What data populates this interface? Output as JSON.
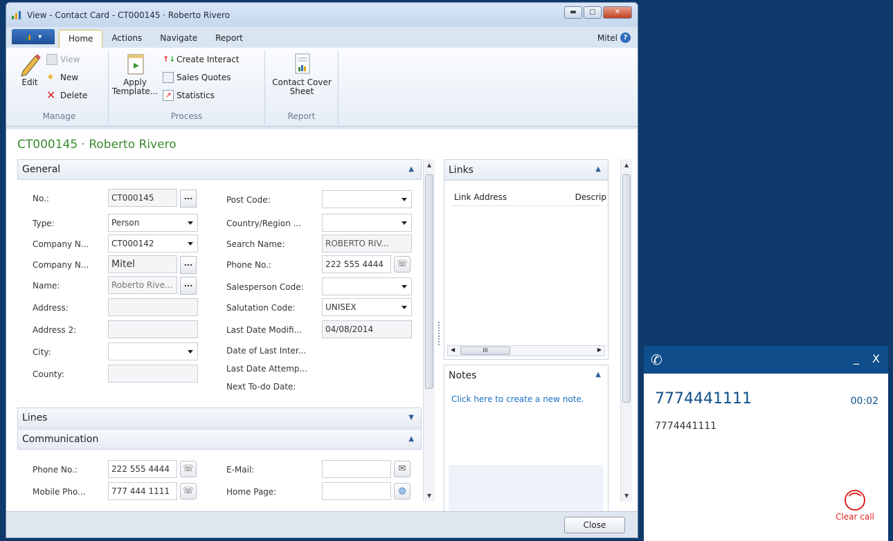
{
  "window": {
    "title": "View - Contact Card - CT000145 · Roberto Rivero"
  },
  "tabs": [
    "Home",
    "Actions",
    "Navigate",
    "Report"
  ],
  "company_label": "Mitel",
  "ribbon": {
    "manage": {
      "edit": "Edit",
      "view": "View",
      "new": "New",
      "delete": "Delete",
      "label": "Manage"
    },
    "process": {
      "apply_template": "Apply Template...",
      "create_interact": "Create Interact",
      "sales_quotes": "Sales Quotes",
      "statistics": "Statistics",
      "label": "Process"
    },
    "report": {
      "cover_sheet": "Contact Cover Sheet",
      "label": "Report"
    }
  },
  "page_title": "CT000145 · Roberto Rivero",
  "general": {
    "header": "General",
    "no_label": "No.:",
    "no_value": "CT000145",
    "type_label": "Type:",
    "type_value": "Person",
    "company_no_label": "Company N...",
    "company_no_value": "CT000142",
    "company_name_label": "Company N...",
    "company_name_value": "Mitel",
    "name_label": "Name:",
    "name_value": "Roberto Rive...",
    "address_label": "Address:",
    "address2_label": "Address 2:",
    "city_label": "City:",
    "county_label": "County:",
    "post_code_label": "Post Code:",
    "country_label": "Country/Region ...",
    "search_name_label": "Search Name:",
    "search_name_value": "ROBERTO RIV...",
    "phone_label": "Phone No.:",
    "phone_value": "222 555 4444",
    "salesperson_label": "Salesperson Code:",
    "salutation_label": "Salutation Code:",
    "salutation_value": "UNISEX",
    "last_modified_label": "Last Date Modifi...",
    "last_modified_value": "04/08/2014",
    "last_interact_label": "Date of Last Inter...",
    "last_attempt_label": "Last Date Attemp...",
    "next_todo_label": "Next To-do Date:"
  },
  "lines": {
    "header": "Lines"
  },
  "communication": {
    "header": "Communication",
    "phone_label": "Phone No.:",
    "phone_value": "222 555 4444",
    "mobile_label": "Mobile Pho...",
    "mobile_value": "777 444 1111",
    "email_label": "E-Mail:",
    "homepage_label": "Home Page:"
  },
  "links": {
    "header": "Links",
    "col_address": "Link Address",
    "col_desc": "Descrip"
  },
  "notes": {
    "header": "Notes",
    "link": "Click here to create a new note."
  },
  "bottom": {
    "close": "Close"
  },
  "call": {
    "number": "7774441111",
    "timer": "00:02",
    "caller": "7774441111",
    "clear": "Clear call",
    "minimize": "_",
    "close": "X"
  }
}
